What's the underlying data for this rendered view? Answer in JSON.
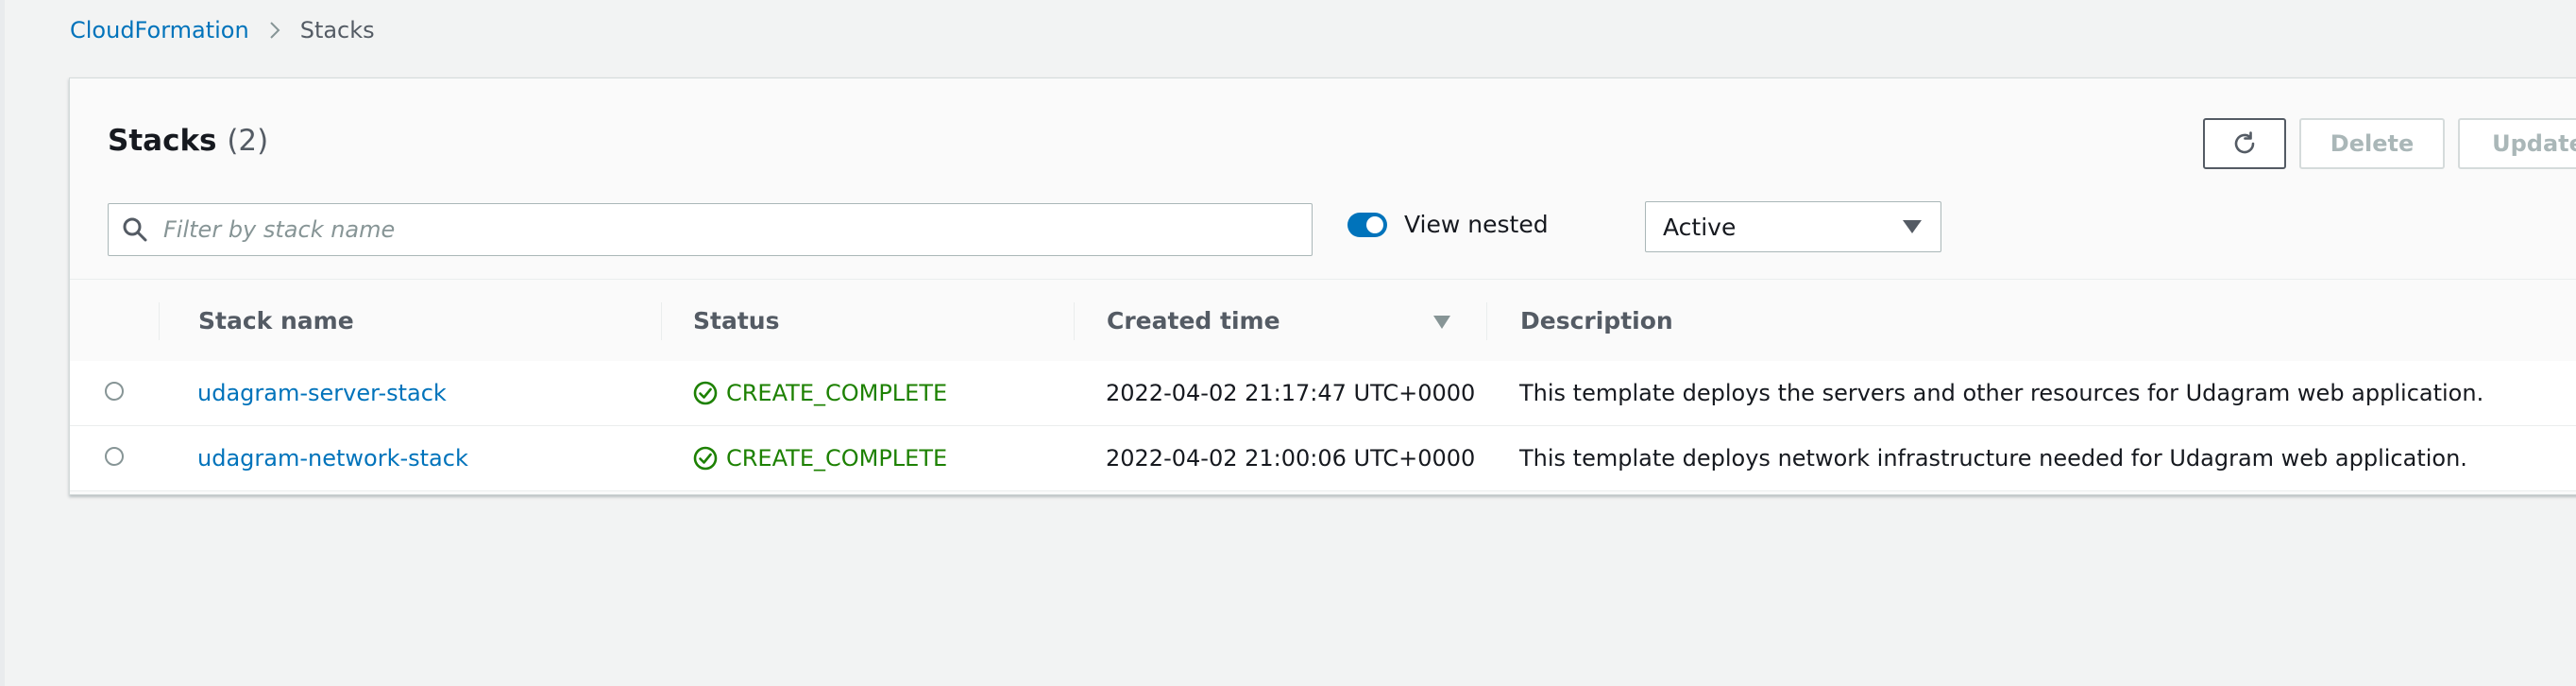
{
  "breadcrumb": {
    "items": [
      {
        "label": "CloudFormation"
      },
      {
        "label": "Stacks"
      }
    ]
  },
  "panel": {
    "title": "Stacks",
    "count": "(2)"
  },
  "buttons": {
    "refresh_icon": "refresh-icon",
    "delete_label": "Delete",
    "update_label": "Update"
  },
  "filter": {
    "placeholder": "Filter by stack name",
    "value": ""
  },
  "toggle": {
    "label": "View nested",
    "on": true
  },
  "select": {
    "value": "Active"
  },
  "table": {
    "columns": [
      "Stack name",
      "Status",
      "Created time",
      "Description"
    ],
    "rows": [
      {
        "name": "udagram-server-stack",
        "status": "CREATE_COMPLETE",
        "created": "2022-04-02 21:17:47 UTC+0000",
        "description": "This template deploys the servers and other resources for Udagram web application."
      },
      {
        "name": "udagram-network-stack",
        "status": "CREATE_COMPLETE",
        "created": "2022-04-02 21:00:06 UTC+0000",
        "description": "This template deploys network infrastructure needed for Udagram web application."
      }
    ]
  },
  "colors": {
    "link": "#0073bb",
    "success": "#1d8102",
    "toggle_on": "#0073bb"
  }
}
